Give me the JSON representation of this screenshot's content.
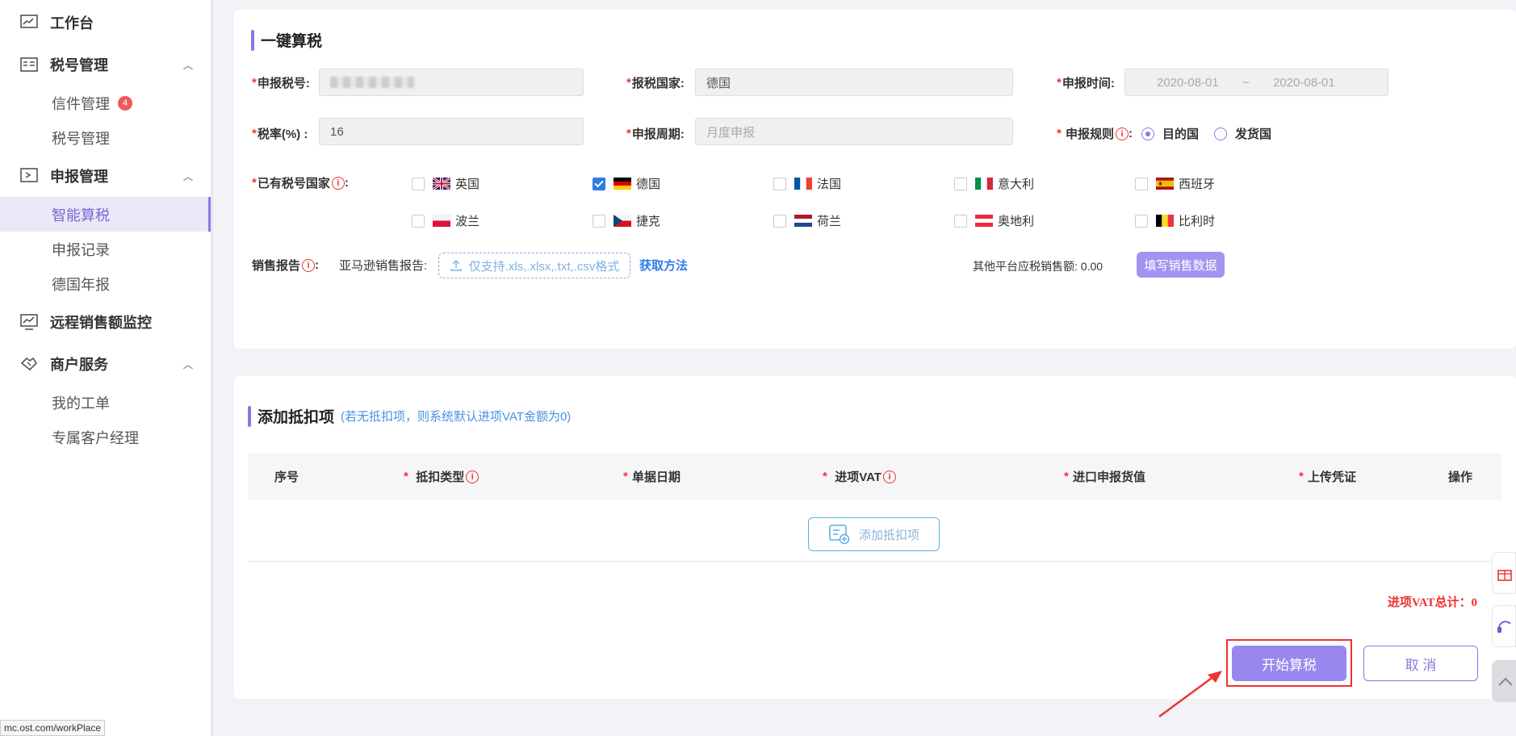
{
  "sidebar": {
    "workbench": "工作台",
    "tax_id_group": "税号管理",
    "mail_mgmt": "信件管理",
    "mail_badge": "4",
    "tax_id_mgmt": "税号管理",
    "filing_group": "申报管理",
    "smart_calc": "智能算税",
    "filing_records": "申报记录",
    "germany_annual": "德国年报",
    "remote_sales": "远程销售额监控",
    "merchant_group": "商户服务",
    "my_tickets": "我的工单",
    "account_manager": "专属客户经理",
    "url_tip": "mc.ost.com/workPlace"
  },
  "calc": {
    "title": "一键算税",
    "tax_id_label": "申报税号:",
    "country_label": "报税国家:",
    "country_value": "德国",
    "time_label": "申报时间:",
    "date_start": "2020-08-01",
    "date_sep": "~",
    "date_end": "2020-08-01",
    "rate_label": "税率(%) :",
    "rate_value": "16",
    "period_label": "申报周期:",
    "period_placeholder": "月度申报",
    "rule_label": "申报规则",
    "rule_dest": "目的国",
    "rule_ship": "发货国",
    "existing_label": "已有税号国家",
    "countries": [
      "英国",
      "德国",
      "法国",
      "意大利",
      "西班牙",
      "波兰",
      "捷克",
      "荷兰",
      "奥地利",
      "比利时"
    ],
    "sales_label": "销售报告",
    "amazon_label": "亚马逊销售报告:",
    "upload_text": "仅支持.xls,.xlsx,.txt,.csv格式",
    "get_method": "获取方法",
    "other_label": "其他平台应税销售额:",
    "other_value": "0.00",
    "fill_btn": "填写销售数据"
  },
  "deduct": {
    "title": "添加抵扣项",
    "hint": "(若无抵扣项，则系统默认进项VAT金额为0)",
    "headers": {
      "seq": "序号",
      "type": "抵扣类型",
      "date": "单据日期",
      "vat": "进项VAT",
      "value": "进口申报货值",
      "proof": "上传凭证",
      "action": "操作"
    },
    "add_btn": "添加抵扣项",
    "total": "进项VAT总计：0",
    "start_btn": "开始算税",
    "cancel_btn": "取 消"
  },
  "colors": {
    "accent": "#8a78e0",
    "link": "#2f7be5",
    "required": "#e33333"
  }
}
